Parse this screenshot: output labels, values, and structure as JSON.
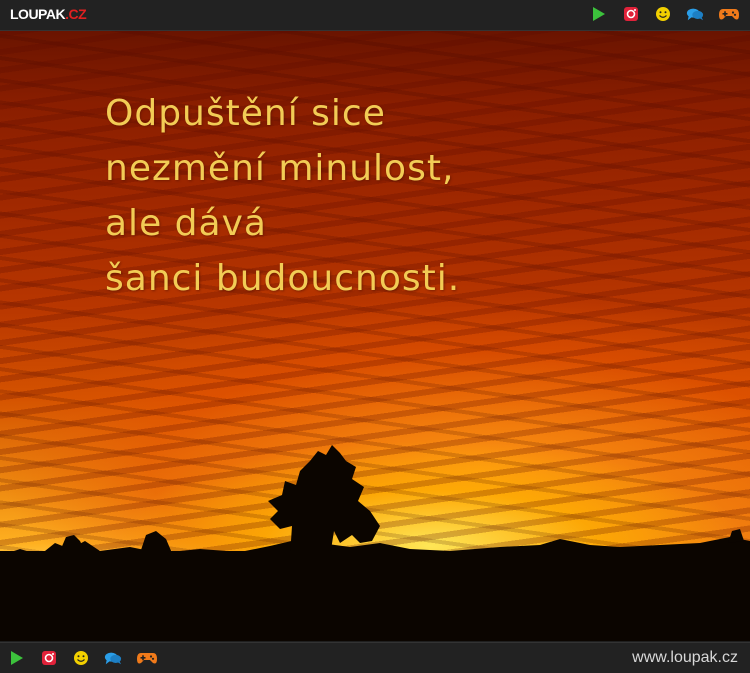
{
  "header": {
    "logo_main": "LOUPAK",
    "logo_tld": ".CZ",
    "icons": [
      "play-icon",
      "instagram-icon",
      "smiley-icon",
      "chat-icon",
      "gamepad-icon"
    ]
  },
  "image": {
    "quote_lines": [
      "Odpuštění sice",
      "nezmění minulost,",
      "ale dává",
      "šanci budoucnosti."
    ]
  },
  "footer": {
    "icons": [
      "play-icon",
      "instagram-icon",
      "smiley-icon",
      "chat-icon",
      "gamepad-icon"
    ],
    "site_url": "www.loupak.cz"
  },
  "colors": {
    "play": "#3cc23c",
    "instagram": "#e0223a",
    "smiley": "#f2d000",
    "chat": "#2a9ee8",
    "gamepad": "#f07a1a",
    "quote_text": "#f2cc55"
  }
}
